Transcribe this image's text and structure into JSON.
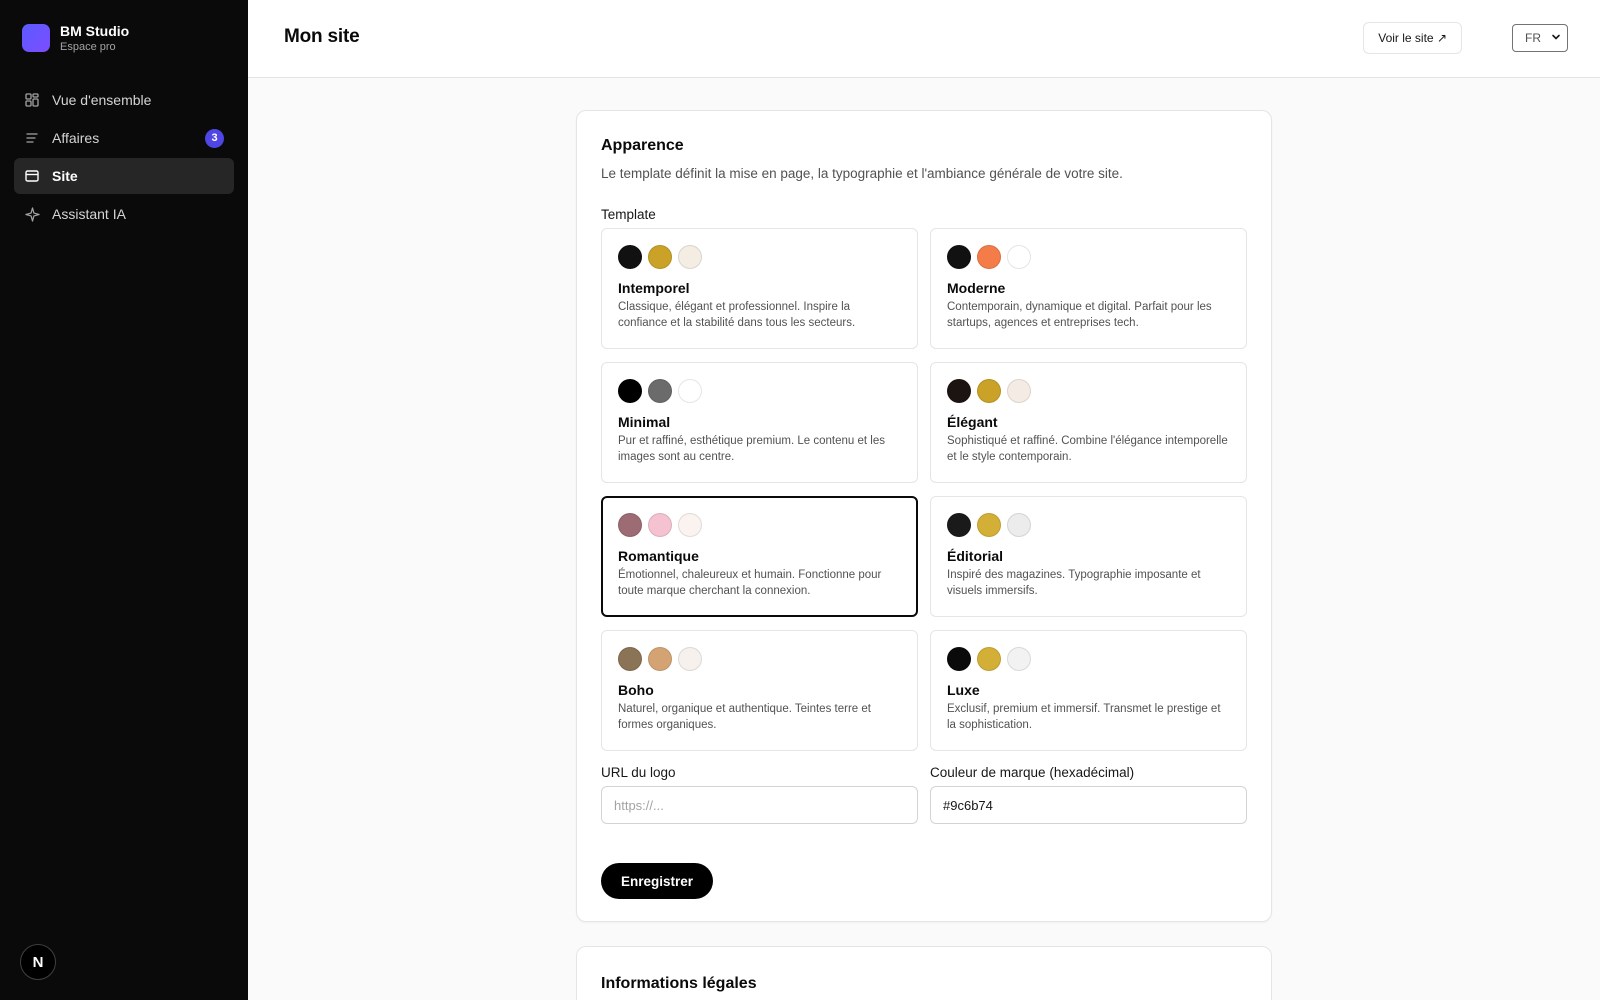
{
  "app": {
    "name": "BM Studio",
    "subtitle": "Espace pro",
    "logo_color": "#5b5bff"
  },
  "sidebar": {
    "items": [
      {
        "label": "Vue d'ensemble",
        "icon": "grid-icon",
        "active": false
      },
      {
        "label": "Affaires",
        "icon": "list-icon",
        "badge": "3",
        "active": false
      },
      {
        "label": "Site",
        "icon": "window-icon",
        "active": true
      },
      {
        "label": "Assistant IA",
        "icon": "sparkle-icon",
        "active": false
      }
    ],
    "avatar_letter": "N"
  },
  "header": {
    "title": "Mon site",
    "view_site_label": "Voir le site ↗",
    "language": "FR"
  },
  "appearance": {
    "title": "Apparence",
    "description": "Le template définit la mise en page, la typographie et l'ambiance générale de votre site.",
    "template_label": "Template",
    "templates": [
      {
        "name": "Intemporel",
        "description": "Classique, élégant et professionnel. Inspire la confiance et la stabilité dans tous les secteurs.",
        "colors": [
          "#111111",
          "#c9a227",
          "#f3ede4"
        ],
        "selected": false
      },
      {
        "name": "Moderne",
        "description": "Contemporain, dynamique et digital. Parfait pour les startups, agences et entreprises tech.",
        "colors": [
          "#111111",
          "#f47c48",
          "#ffffff"
        ],
        "selected": false
      },
      {
        "name": "Minimal",
        "description": "Pur et raffiné, esthétique premium. Le contenu et les images sont au centre.",
        "colors": [
          "#000000",
          "#6b6b6b",
          "#ffffff"
        ],
        "selected": false
      },
      {
        "name": "Élégant",
        "description": "Sophistiqué et raffiné. Combine l'élégance intemporelle et le style contemporain.",
        "colors": [
          "#1c1410",
          "#c9a227",
          "#f4ece4"
        ],
        "selected": false
      },
      {
        "name": "Romantique",
        "description": "Émotionnel, chaleureux et humain. Fonctionne pour toute marque cherchant la connexion.",
        "colors": [
          "#9c6b74",
          "#f4c2d0",
          "#fbf3ef"
        ],
        "selected": true
      },
      {
        "name": "Éditorial",
        "description": "Inspiré des magazines. Typographie imposante et visuels immersifs.",
        "colors": [
          "#1a1a1a",
          "#d4af37",
          "#ececec"
        ],
        "selected": false
      },
      {
        "name": "Boho",
        "description": "Naturel, organique et authentique. Teintes terre et formes organiques.",
        "colors": [
          "#8b7355",
          "#d4a373",
          "#f6f1ec"
        ],
        "selected": false
      },
      {
        "name": "Luxe",
        "description": "Exclusif, premium et immersif. Transmet le prestige et la sophistication.",
        "colors": [
          "#0a0a0a",
          "#d4af37",
          "#f2f2f2"
        ],
        "selected": false
      }
    ],
    "logo_url_label": "URL du logo",
    "logo_url_placeholder": "https://...",
    "logo_url_value": "",
    "brand_color_label": "Couleur de marque (hexadécimal)",
    "brand_color_value": "#9c6b74",
    "save_label": "Enregistrer"
  },
  "legal": {
    "title": "Informations légales"
  }
}
